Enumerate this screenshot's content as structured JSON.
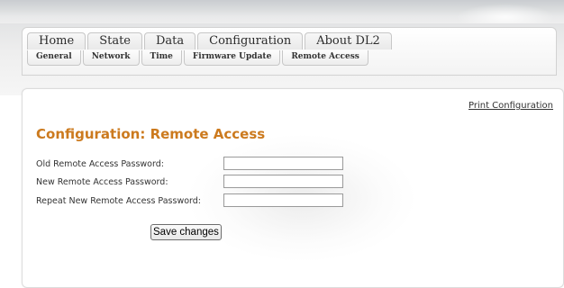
{
  "nav": {
    "main_tabs": [
      {
        "label": "Home"
      },
      {
        "label": "State"
      },
      {
        "label": "Data"
      },
      {
        "label": "Configuration"
      },
      {
        "label": "About DL2"
      }
    ],
    "sub_tabs": [
      {
        "label": "General"
      },
      {
        "label": "Network"
      },
      {
        "label": "Time"
      },
      {
        "label": "Firmware Update"
      },
      {
        "label": "Remote Access"
      }
    ]
  },
  "content": {
    "print_link": "Print Configuration",
    "title": "Configuration: Remote Access",
    "fields": [
      {
        "label": "Old Remote Access Password:",
        "value": ""
      },
      {
        "label": "New Remote Access Password:",
        "value": ""
      },
      {
        "label": "Repeat New Remote Access Password:",
        "value": ""
      }
    ],
    "save_label": "Save changes"
  },
  "colors": {
    "title": "#cc7a1e",
    "accent_bar": "#c9ccd0"
  }
}
